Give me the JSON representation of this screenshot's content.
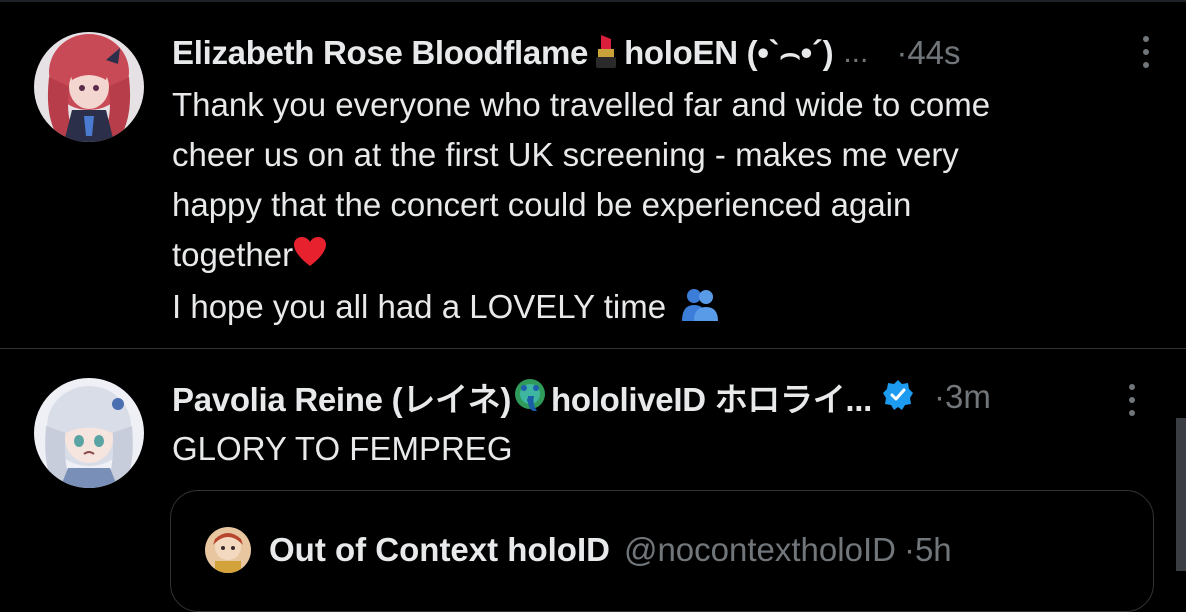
{
  "tweets": [
    {
      "author": "Elizabeth Rose Bloodflame",
      "author_suffix": "holoEN (•`⌢•´)",
      "ellipsis": "...",
      "time": "·44s",
      "lines": [
        "Thank you everyone who travelled far and wide to come",
        "cheer us on at the first UK screening - makes me very",
        "happy that the concert could be experienced again",
        "together",
        "I hope you all had a LOVELY time"
      ],
      "emojis": [
        "lipstick-icon",
        "red-heart-icon",
        "people-hugging-icon"
      ]
    },
    {
      "author": "Pavolia Reine (レイネ)",
      "author_suffix": "hololiveID ホロライ...",
      "time": "·3m",
      "lines": [
        "GLORY TO FEMPREG"
      ],
      "emojis": [
        "peacock-icon",
        "verified-badge-icon"
      ],
      "quote": {
        "author": "Out of Context holoID",
        "handle": "@nocontextholoID",
        "time": "·5h"
      }
    }
  ],
  "colors": {
    "background": "#000000",
    "text": "#e7e9ea",
    "secondary": "#71767b",
    "divider": "#2f3336",
    "verified": "#1d9bf0"
  }
}
